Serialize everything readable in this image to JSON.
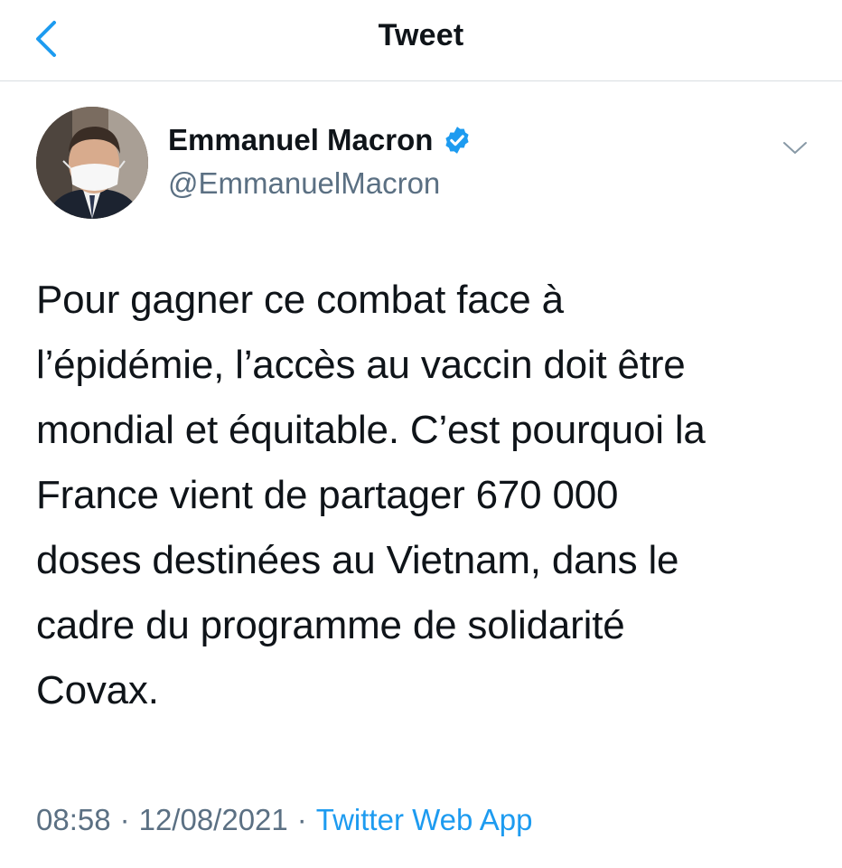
{
  "header": {
    "title": "Tweet",
    "back_icon": "chevron-left-icon",
    "accent": "#1d9bf0"
  },
  "tweet": {
    "author": {
      "display_name": "Emmanuel Macron",
      "handle": "@EmmanuelMacron",
      "verified": true,
      "verified_color": "#1d9bf0"
    },
    "text": "Pour gagner ce combat face à\nl’épidémie, l’accès au vaccin doit être\nmondial et équitable. C’est pourquoi la\nFrance vient de partager 670 000\ndoses destinées au Vietnam, dans le\ncadre du programme de solidarité\nCovax.",
    "time": "08:58",
    "date": "12/08/2021",
    "separator": "·",
    "source": "Twitter Web App"
  }
}
